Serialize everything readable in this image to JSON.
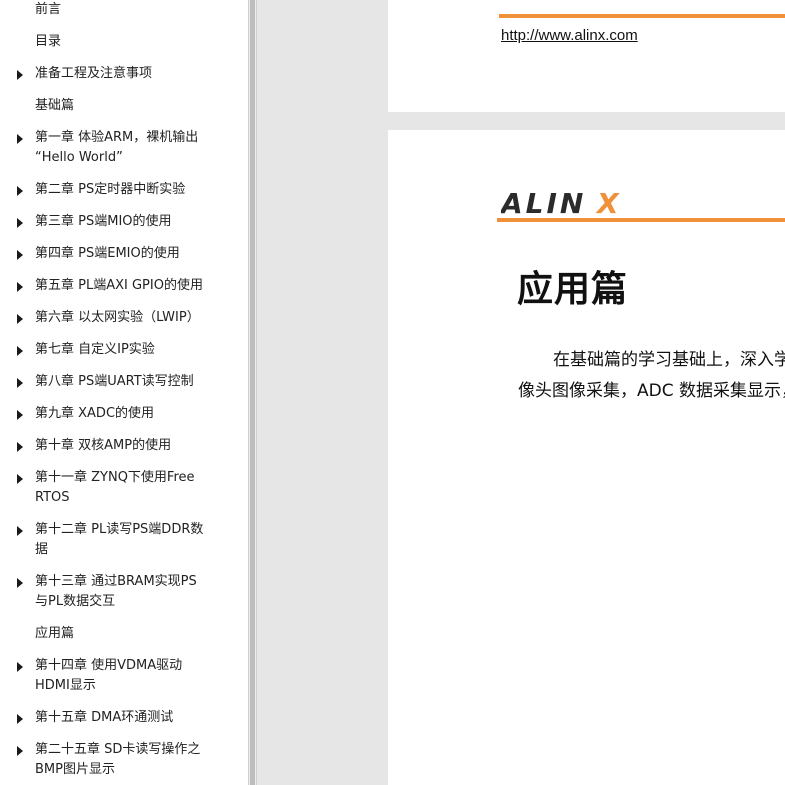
{
  "sidebar": {
    "items": [
      {
        "label": "前言",
        "expandable": false
      },
      {
        "label": "目录",
        "expandable": false
      },
      {
        "label": "准备工程及注意事项",
        "expandable": true
      },
      {
        "label": "基础篇",
        "expandable": false
      },
      {
        "label": "第一章 体验ARM，裸机输出\n“Hello World”",
        "expandable": true
      },
      {
        "label": "第二章 PS定时器中断实验",
        "expandable": true
      },
      {
        "label": "第三章 PS端MIO的使用",
        "expandable": true
      },
      {
        "label": "第四章 PS端EMIO的使用",
        "expandable": true
      },
      {
        "label": "第五章 PL端AXI GPIO的使用",
        "expandable": true
      },
      {
        "label": "第六章 以太网实验（LWIP）",
        "expandable": true
      },
      {
        "label": "第七章 自定义IP实验",
        "expandable": true
      },
      {
        "label": "第八章 PS端UART读写控制",
        "expandable": true
      },
      {
        "label": "第九章 XADC的使用",
        "expandable": true
      },
      {
        "label": "第十章 双核AMP的使用",
        "expandable": true
      },
      {
        "label": "第十一章 ZYNQ下使用Free\nRTOS",
        "expandable": true
      },
      {
        "label": "第十二章 PL读写PS端DDR数\n据",
        "expandable": true
      },
      {
        "label": "第十三章 通过BRAM实现PS\n与PL数据交互",
        "expandable": true
      },
      {
        "label": "应用篇",
        "expandable": false
      },
      {
        "label": "第十四章 使用VDMA驱动\nHDMI显示",
        "expandable": true
      },
      {
        "label": "第十五章 DMA环通测试",
        "expandable": true
      },
      {
        "label": "第二十五章 SD卡读写操作之\nBMP图片显示",
        "expandable": true
      }
    ]
  },
  "document": {
    "header_url": "http://www.alinx.com",
    "logo_text": "ALINX",
    "chapter_title": "应用篇",
    "paragraph_lines": [
      "在基础篇的学习基础上，深入学",
      "像头图像采集，ADC 数据采集显示，"
    ]
  },
  "colors": {
    "accent_orange": "#f0913a",
    "logo_dark": "#2b2b2b"
  }
}
